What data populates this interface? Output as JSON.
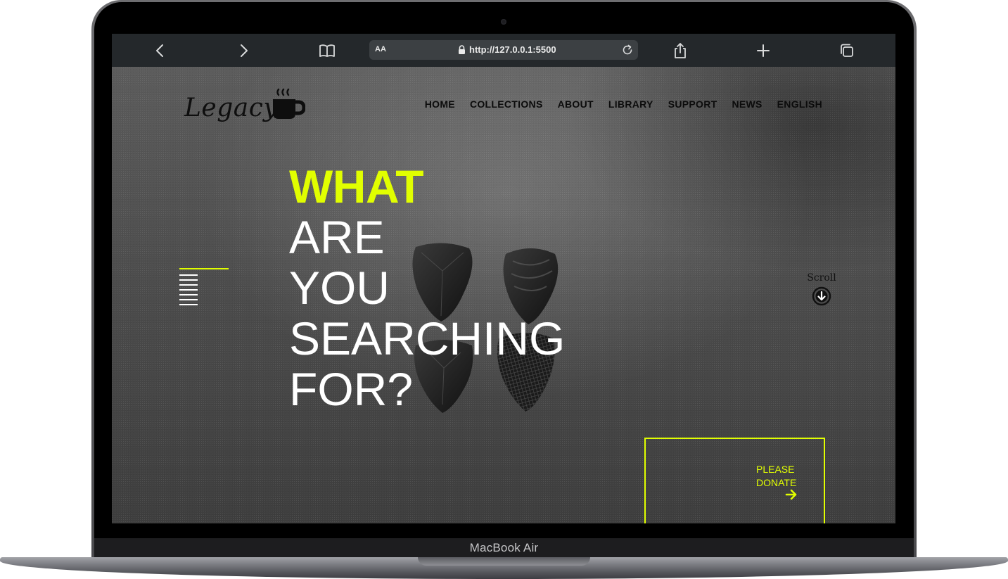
{
  "device": {
    "label": "MacBook Air"
  },
  "browser": {
    "text_size_label": "AA",
    "url": "http://127.0.0.1:5500"
  },
  "site": {
    "logo_text": "Legacy",
    "nav": [
      "HOME",
      "COLLECTIONS",
      "ABOUT",
      "LIBRARY",
      "SUPPORT",
      "NEWS",
      "ENGLISH"
    ],
    "headline": {
      "accent": "WHAT",
      "lines": [
        "ARE",
        "YOU",
        "SEARCHING",
        "FOR?"
      ]
    },
    "scroll_label": "Scroll",
    "donate": {
      "line1": "PLEASE",
      "line2": "DONATE"
    }
  },
  "colors": {
    "accent": "#e1ff00",
    "toolbar": "#24282b",
    "text_dark": "#0b0b0b"
  },
  "icons": [
    "back-icon",
    "forward-icon",
    "bookmarks-icon",
    "lock-icon",
    "reload-icon",
    "share-icon",
    "new-tab-icon",
    "tabs-icon",
    "coffee-cup-icon",
    "scroll-down-icon",
    "arrow-right-icon"
  ]
}
